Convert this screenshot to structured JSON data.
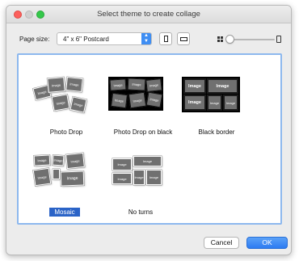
{
  "window": {
    "title": "Select theme to create collage"
  },
  "toolbar": {
    "page_size_label": "Page size:",
    "page_size_value": "4\" x 6\" Postcard",
    "orientation_selected": "landscape",
    "zoom_level": 0.0
  },
  "thumbnail_label": "Image",
  "themes": [
    {
      "caption": "Photo Drop",
      "selected": false
    },
    {
      "caption": "Photo Drop on black",
      "selected": false
    },
    {
      "caption": "Black border",
      "selected": false
    },
    {
      "caption": "Mosaic",
      "selected": true
    },
    {
      "caption": "No turns",
      "selected": false
    }
  ],
  "buttons": {
    "cancel": "Cancel",
    "ok": "OK"
  },
  "colors": {
    "accent": "#2c7bf2",
    "selection": "#2a63c7",
    "panel_border": "#8db8ee"
  }
}
